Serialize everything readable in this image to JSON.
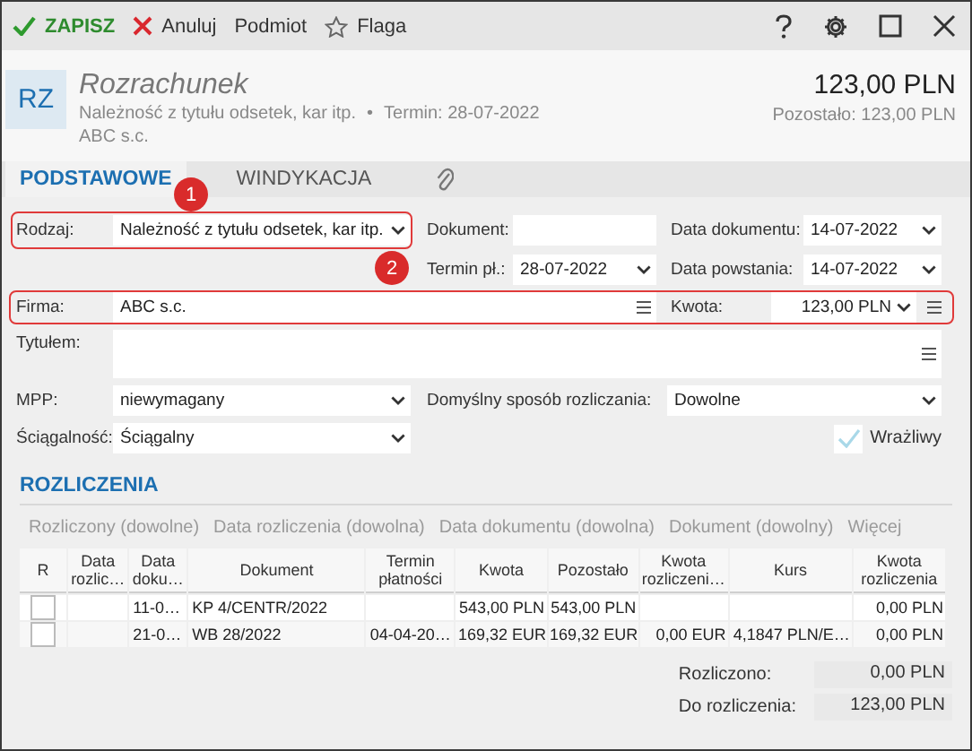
{
  "toolbar": {
    "actions": [
      {
        "label": "ZAPISZ",
        "kind": "save"
      },
      {
        "label": "Anuluj",
        "kind": "cancel"
      },
      {
        "label": "Podmiot",
        "kind": "plain"
      },
      {
        "label": "Flaga",
        "kind": "flag"
      }
    ],
    "window_buttons": [
      {
        "kind": "help"
      },
      {
        "kind": "settings"
      },
      {
        "kind": "maximize"
      },
      {
        "kind": "close"
      }
    ]
  },
  "header": {
    "badge": "RZ",
    "title": "Rozrachunek",
    "subtitle": "Należność z tytułu odsetek, kar itp.",
    "separator": "•",
    "due": "Termin: 28-07-2022",
    "company": "ABC s.c.",
    "amount": "123,00 PLN",
    "remaining": "Pozostało: 123,00 PLN"
  },
  "tabs": [
    {
      "label": "PODSTAWOWE",
      "kind": "text",
      "selected": true
    },
    {
      "label": "WINDYKACJA",
      "kind": "text",
      "selected": false
    },
    {
      "kind": "attachment",
      "selected": false
    }
  ],
  "form": {
    "rows": [
      {
        "kind": "three",
        "cells": [
          {
            "label": "Rodzaj:",
            "value": "Należność z tytułu odsetek, kar itp.",
            "kind": "select",
            "highlighted": true
          },
          {
            "label": "Dokument:",
            "kind": "text"
          },
          {
            "label": "Data dokumentu:",
            "value": "14-07-2022",
            "kind": "select"
          }
        ]
      },
      {
        "kind": "two-right",
        "cells": [
          {
            "label": "Termin pł.:",
            "value": "28-07-2022",
            "kind": "select"
          },
          {
            "label": "Data powstania:",
            "value": "14-07-2022",
            "kind": "select"
          }
        ]
      },
      {
        "kind": "firm",
        "highlighted": true,
        "cells": [
          {
            "label": "Firma:",
            "value": "ABC s.c.",
            "kind": "lookup"
          },
          {
            "label": "Kwota:",
            "value": "123,00 PLN",
            "kind": "amount"
          }
        ]
      },
      {
        "kind": "memo",
        "cells": [
          {
            "label": "Tytułem:",
            "kind": "memo"
          }
        ]
      },
      {
        "kind": "pair",
        "cells": [
          {
            "label": "MPP:",
            "value": "niewymagany",
            "kind": "select"
          },
          {
            "label": "Domyślny sposób rozliczania:",
            "value": "Dowolne",
            "kind": "select"
          }
        ]
      },
      {
        "kind": "check",
        "cells": [
          {
            "label": "Ściągalność:",
            "value": "Ściągalny",
            "kind": "select"
          },
          {
            "label": "Wrażliwy",
            "kind": "checkbox",
            "checked": true
          }
        ]
      }
    ],
    "callouts": [
      "1",
      "2"
    ]
  },
  "settlements": {
    "title": "ROZLICZENIA",
    "filters": [
      "Rozliczony (dowolne)",
      "Data rozliczenia (dowolna)",
      "Data dokumentu (dowolna)",
      "Dokument (dowolny)",
      "Więcej"
    ],
    "table": {
      "columns": [
        "R",
        "Data rozlic…",
        "Data doku…",
        "Dokument",
        "Termin płatności",
        "Kwota",
        "Pozostało",
        "Kwota rozliczeni…",
        "Kurs",
        "Kwota rozliczenia"
      ],
      "rows": [
        {
          "checked": false,
          "cells": [
            "",
            "",
            "11-0…",
            "KP 4/CENTR/2022",
            "",
            "543,00 PLN",
            "543,00 PLN",
            "",
            "",
            "0,00 PLN"
          ]
        },
        {
          "checked": false,
          "cells": [
            "",
            "",
            "21-0…",
            "WB 28/2022",
            "04-04-20…",
            "169,32 EUR",
            "169,32 EUR",
            "0,00 EUR",
            "4,1847 PLN/E…",
            "0,00 PLN"
          ]
        }
      ]
    },
    "totals": [
      {
        "label": "Rozliczono:",
        "value": "0,00 PLN"
      },
      {
        "label": "Do rozliczenia:",
        "value": "123,00 PLN"
      }
    ]
  }
}
